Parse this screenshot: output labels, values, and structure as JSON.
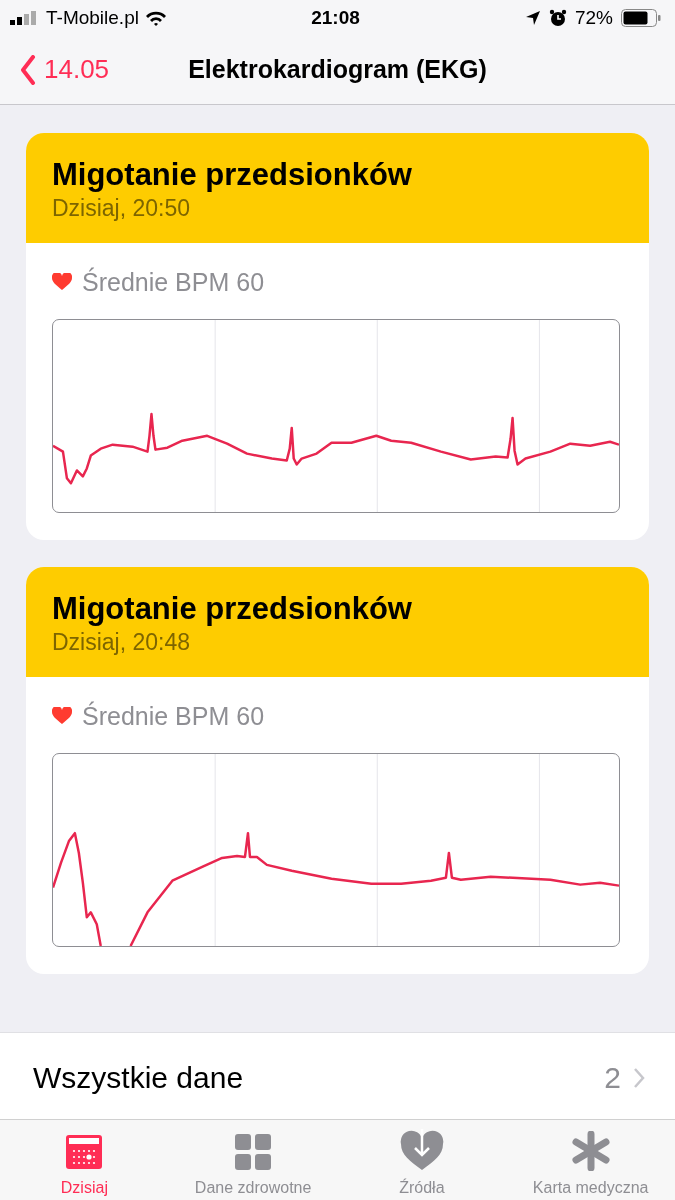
{
  "status_bar": {
    "carrier": "T-Mobile.pl",
    "time": "21:08",
    "battery": "72%"
  },
  "nav": {
    "back": "14.05",
    "title": "Elektrokardiogram (EKG)"
  },
  "recordings": [
    {
      "classification": "Migotanie przedsionków",
      "date": "Dzisiaj, 20:50",
      "bpm": "Średnie BPM 60"
    },
    {
      "classification": "Migotanie przedsionków",
      "date": "Dzisiaj, 20:48",
      "bpm": "Średnie BPM 60"
    }
  ],
  "all_data": {
    "label": "Wszystkie dane",
    "count": "2"
  },
  "tabs": [
    {
      "label": "Dzisiaj",
      "selected": true
    },
    {
      "label": "Dane zdrowotne",
      "selected": false
    },
    {
      "label": "Źródła",
      "selected": false
    },
    {
      "label": "Karta medyczna",
      "selected": false
    }
  ]
}
